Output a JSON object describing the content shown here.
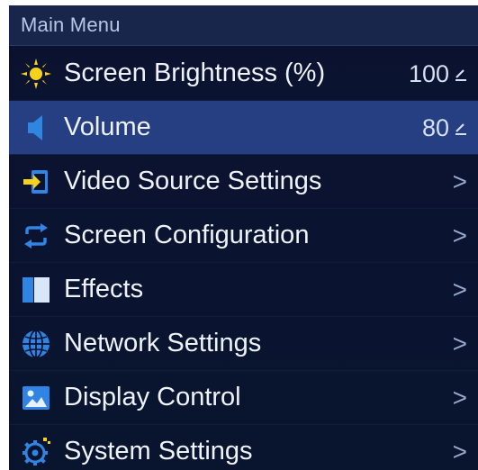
{
  "header": {
    "title": "Main Menu"
  },
  "items": [
    {
      "label": "Screen Brightness (%)",
      "value": "100",
      "icon": "sun-icon",
      "right": "edit-icon"
    },
    {
      "label": "Volume",
      "value": "80",
      "icon": "speaker-icon",
      "right": "edit-icon"
    },
    {
      "label": "Video Source Settings",
      "icon": "input-source-icon",
      "right": "chevron-right-icon",
      "chevron": ">"
    },
    {
      "label": "Screen Configuration",
      "icon": "refresh-loop-icon",
      "right": "chevron-right-icon",
      "chevron": ">"
    },
    {
      "label": "Effects",
      "icon": "effects-panel-icon",
      "right": "chevron-right-icon",
      "chevron": ">"
    },
    {
      "label": "Network Settings",
      "icon": "globe-icon",
      "right": "chevron-right-icon",
      "chevron": ">"
    },
    {
      "label": "Display Control",
      "icon": "picture-icon",
      "right": "chevron-right-icon",
      "chevron": ">"
    },
    {
      "label": "System Settings",
      "icon": "gear-icon",
      "right": "chevron-right-icon",
      "chevron": ">"
    }
  ],
  "colors": {
    "header_bg": "#18264c",
    "selected_bg": "#263e82",
    "menu_bg": "#0b1330",
    "sun_yellow": "#f8d11a",
    "speaker_blue": "#2e86e0",
    "accent_blue": "#2f84e4"
  }
}
